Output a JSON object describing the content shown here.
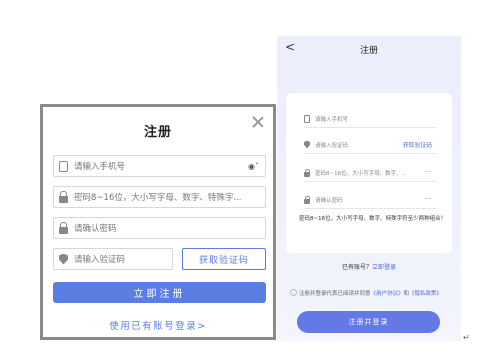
{
  "desktop": {
    "title": "注册",
    "phone_placeholder": "请输入手机号",
    "password_placeholder": "密码8~16位，大小写字母、数字、特殊字...",
    "confirm_placeholder": "请确认密码",
    "code_placeholder": "请输入验证码",
    "get_code": "获取验证码",
    "register": "立即注册",
    "login_link": "使用已有账号登录>"
  },
  "mobile": {
    "back": "<",
    "title": "注册",
    "phone_placeholder": "请输入手机号",
    "code_placeholder": "请输入验证码",
    "get_code": "获取验证码",
    "password_placeholder": "密码8~16位，大小写字母、数字、...",
    "confirm_placeholder": "请确认密码",
    "dots": "···",
    "hint": "密码8~16位，大小写字母、数字、特殊字符至少两种组合！",
    "have_account": "已有账号？",
    "login_link": "立即登录",
    "agree_prefix": "注册并登录代表已阅读并同意",
    "user_agreement": "《用户协议》",
    "and": "和",
    "privacy_policy": "《隐私政策》",
    "submit": "注册并登录"
  },
  "para_mark": "↵",
  "colors": {
    "accent": "#5b7ee5",
    "mobile_accent": "#6478e6"
  }
}
